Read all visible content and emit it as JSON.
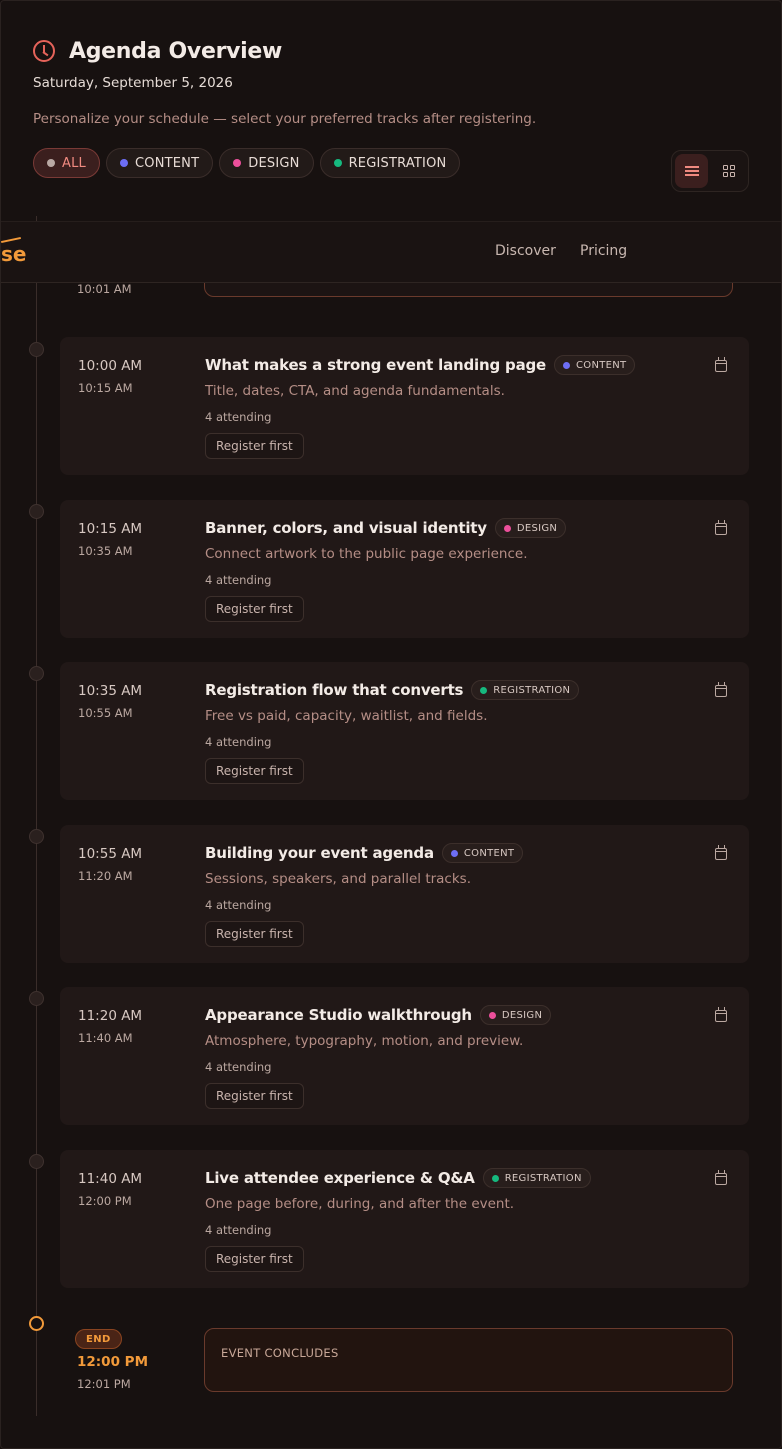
{
  "header": {
    "title": "Agenda Overview",
    "date": "Saturday, September 5, 2026",
    "subtitle": "Personalize your schedule — select your preferred tracks after registering."
  },
  "filters": [
    {
      "label": "ALL",
      "color": "#b9a9a4",
      "active": true
    },
    {
      "label": "CONTENT",
      "color": "#6d6ef5",
      "active": false
    },
    {
      "label": "DESIGN",
      "color": "#ec4f9b",
      "active": false
    },
    {
      "label": "REGISTRATION",
      "color": "#16b97f",
      "active": false
    }
  ],
  "view_toggle": {
    "list_icon": "list-icon",
    "grid_icon": "grid-icon",
    "selected": "list"
  },
  "navbar": {
    "logo_fragment": "se",
    "links": [
      "Discover",
      "Pricing"
    ]
  },
  "previous_session": {
    "end_time": "10:01 AM"
  },
  "sessions": [
    {
      "start": "10:00 AM",
      "end": "10:15 AM",
      "title": "What makes a strong event landing page",
      "tag": "CONTENT",
      "tag_color": "#6d6ef5",
      "description": "Title, dates, CTA, and agenda fundamentals.",
      "attending": "4 attending",
      "action": "Register first"
    },
    {
      "start": "10:15 AM",
      "end": "10:35 AM",
      "title": "Banner, colors, and visual identity",
      "tag": "DESIGN",
      "tag_color": "#ec4f9b",
      "description": "Connect artwork to the public page experience.",
      "attending": "4 attending",
      "action": "Register first"
    },
    {
      "start": "10:35 AM",
      "end": "10:55 AM",
      "title": "Registration flow that converts",
      "tag": "REGISTRATION",
      "tag_color": "#16b97f",
      "description": "Free vs paid, capacity, waitlist, and fields.",
      "attending": "4 attending",
      "action": "Register first"
    },
    {
      "start": "10:55 AM",
      "end": "11:20 AM",
      "title": "Building your event agenda",
      "tag": "CONTENT",
      "tag_color": "#6d6ef5",
      "description": "Sessions, speakers, and parallel tracks.",
      "attending": "4 attending",
      "action": "Register first"
    },
    {
      "start": "11:20 AM",
      "end": "11:40 AM",
      "title": "Appearance Studio walkthrough",
      "tag": "DESIGN",
      "tag_color": "#ec4f9b",
      "description": "Atmosphere, typography, motion, and preview.",
      "attending": "4 attending",
      "action": "Register first"
    },
    {
      "start": "11:40 AM",
      "end": "12:00 PM",
      "title": "Live attendee experience & Q&A",
      "tag": "REGISTRATION",
      "tag_color": "#16b97f",
      "description": "One page before, during, and after the event.",
      "attending": "4 attending",
      "action": "Register first"
    }
  ],
  "end": {
    "badge": "END",
    "start": "12:00 PM",
    "end": "12:01 PM",
    "label": "EVENT CONCLUDES"
  }
}
